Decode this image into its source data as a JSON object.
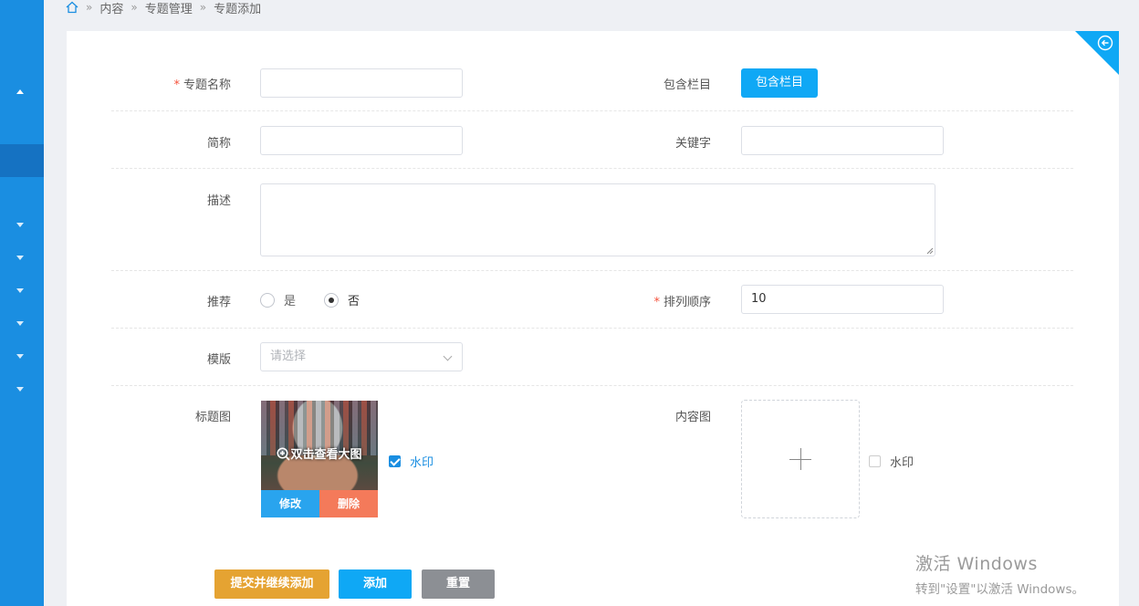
{
  "breadcrumb": {
    "items": [
      "内容",
      "专题管理",
      "专题添加"
    ]
  },
  "form": {
    "name_label": "专题名称",
    "name_required": "*",
    "columns_label": "包含栏目",
    "columns_button": "包含栏目",
    "short_label": "简称",
    "keyword_label": "关键字",
    "desc_label": "描述",
    "recommend_label": "推荐",
    "recommend_yes": "是",
    "recommend_no": "否",
    "recommend_value": "否",
    "order_label": "排列顺序",
    "order_required": "*",
    "order_value": "10",
    "template_label": "模版",
    "template_placeholder": "请选择",
    "title_img_label": "标题图",
    "title_img_overlay": "双击查看大图",
    "title_img_edit": "修改",
    "title_img_delete": "删除",
    "watermark_label": "水印",
    "title_watermark_checked": true,
    "content_img_label": "内容图",
    "content_watermark_checked": false
  },
  "actions": {
    "submit_continue": "提交并继续添加",
    "add": "添加",
    "reset": "重置"
  },
  "colors": {
    "sidebar": "#1a8ee1",
    "primary": "#0fa8f5",
    "orange": "#e5a332",
    "gray": "#8c8f94",
    "delete": "#f47a5a"
  },
  "os_watermark": {
    "line1": "激活 Windows",
    "line2": "转到\"设置\"以激活 Windows。"
  }
}
